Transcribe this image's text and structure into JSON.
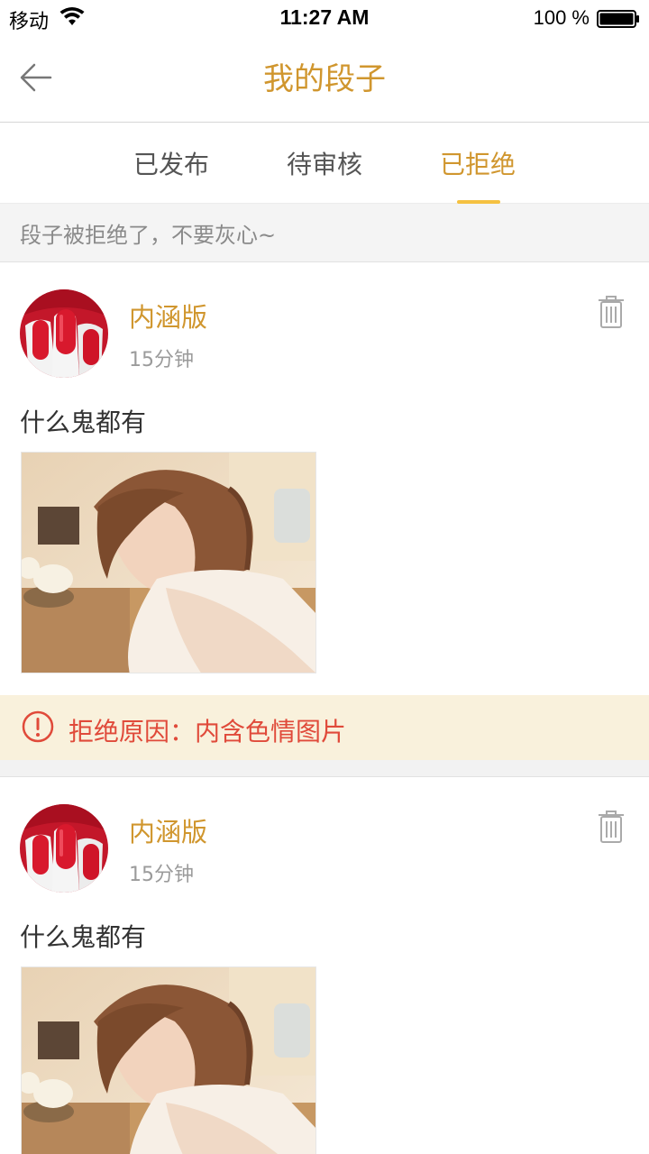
{
  "status_bar": {
    "carrier": "移动",
    "time": "11:27 AM",
    "battery": "100 %"
  },
  "nav": {
    "title": "我的段子"
  },
  "tabs": [
    {
      "label": "已发布",
      "active": false
    },
    {
      "label": "待审核",
      "active": false
    },
    {
      "label": "已拒绝",
      "active": true
    }
  ],
  "notice": "段子被拒绝了，不要灰心~",
  "posts": [
    {
      "author": "内涵版",
      "time": "15分钟",
      "content": "什么鬼都有",
      "reject_reason": "拒绝原因：内含色情图片"
    },
    {
      "author": "内涵版",
      "time": "15分钟",
      "content": "什么鬼都有"
    }
  ],
  "colors": {
    "accent": "#d0962e",
    "tab_indicator": "#f5c141",
    "reject_text": "#e04a3a",
    "reject_bg": "#f9f1dc"
  }
}
